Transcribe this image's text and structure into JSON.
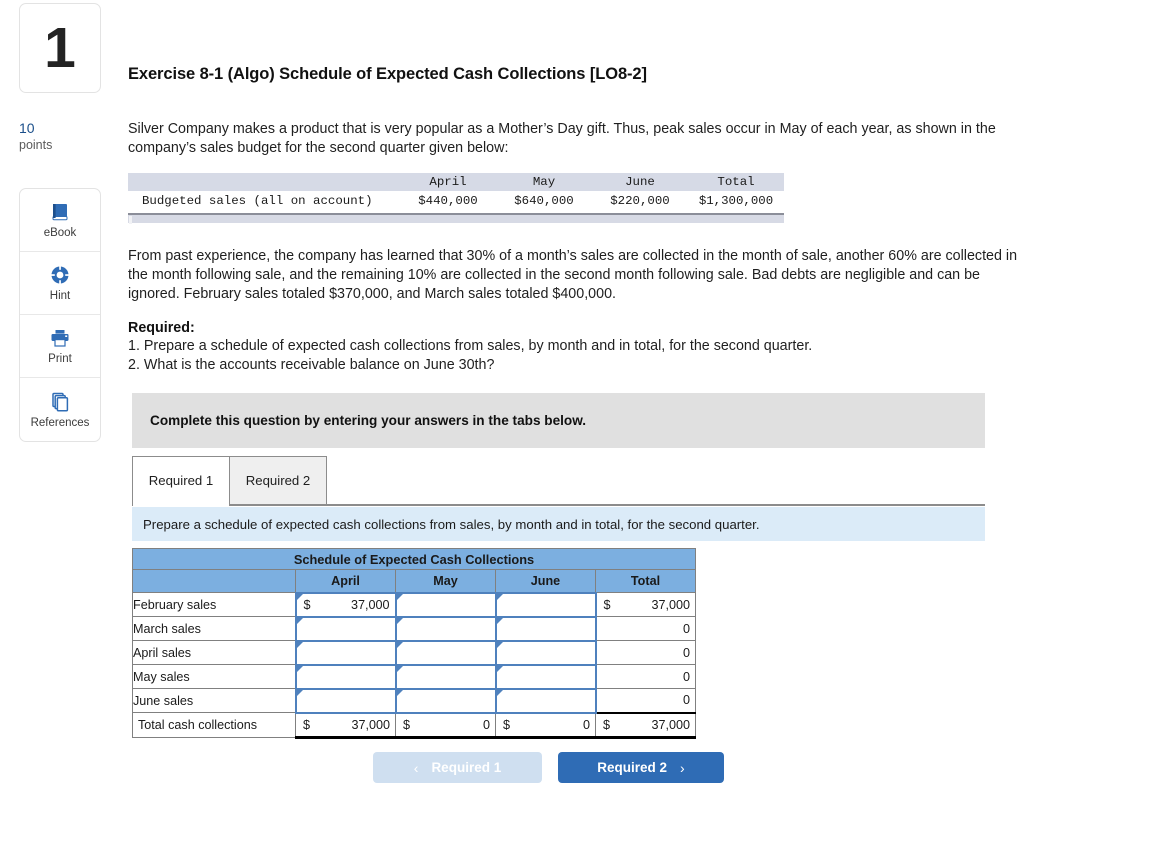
{
  "question": {
    "number": "1",
    "points_value": "10",
    "points_label": "points"
  },
  "tools": [
    {
      "label": "eBook",
      "icon": "book-icon"
    },
    {
      "label": "Hint",
      "icon": "life-ring-icon"
    },
    {
      "label": "Print",
      "icon": "printer-icon"
    },
    {
      "label": "References",
      "icon": "copy-documents-icon"
    }
  ],
  "exercise": {
    "title": "Exercise 8-1 (Algo) Schedule of Expected Cash Collections [LO8-2]",
    "intro": "Silver Company makes a product that is very popular as a Mother’s Day gift. Thus, peak sales occur in May of each year, as shown in the company’s sales budget for the second quarter given below:",
    "policy": "From past experience, the company has learned that 30% of a month’s sales are collected in the month of sale, another 60% are collected in the month following sale, and the remaining 10% are collected in the second month following sale. Bad debts are negligible and can be ignored. February sales totaled $370,000, and March sales totaled $400,000.",
    "required_heading": "Required:",
    "required_1": "1. Prepare a schedule of expected cash collections from sales, by month and in total, for the second quarter.",
    "required_2": "2. What is the accounts receivable balance on June 30th?"
  },
  "budget_table": {
    "columns": [
      "",
      "April",
      "May",
      "June",
      "Total"
    ],
    "row_label": "Budgeted sales (all on account)",
    "values": [
      "$440,000",
      "$640,000",
      "$220,000",
      "$1,300,000"
    ]
  },
  "complete_notice": "Complete this question by entering your answers in the tabs below.",
  "tabs": [
    {
      "label": "Required 1",
      "active": true
    },
    {
      "label": "Required 2",
      "active": false
    }
  ],
  "instruction": "Prepare a schedule of expected cash collections from sales, by month and in total, for the second quarter.",
  "schedule": {
    "title": "Schedule of Expected Cash Collections",
    "headers": [
      "",
      "April",
      "May",
      "June",
      "Total"
    ],
    "rows": [
      {
        "label": "February sales",
        "april_currency": "$",
        "april_value": "37,000",
        "may_currency": "",
        "may_value": "",
        "june_currency": "",
        "june_value": "",
        "total_currency": "$",
        "total_value": "37,000"
      },
      {
        "label": "March sales",
        "april_currency": "",
        "april_value": "",
        "may_currency": "",
        "may_value": "",
        "june_currency": "",
        "june_value": "",
        "total_currency": "",
        "total_value": "0"
      },
      {
        "label": "April sales",
        "april_currency": "",
        "april_value": "",
        "may_currency": "",
        "may_value": "",
        "june_currency": "",
        "june_value": "",
        "total_currency": "",
        "total_value": "0"
      },
      {
        "label": "May sales",
        "april_currency": "",
        "april_value": "",
        "may_currency": "",
        "may_value": "",
        "june_currency": "",
        "june_value": "",
        "total_currency": "",
        "total_value": "0"
      },
      {
        "label": "June sales",
        "april_currency": "",
        "april_value": "",
        "may_currency": "",
        "may_value": "",
        "june_currency": "",
        "june_value": "",
        "total_currency": "",
        "total_value": "0"
      }
    ],
    "total_row": {
      "label": "Total cash collections",
      "april_currency": "$",
      "april_value": "37,000",
      "may_currency": "$",
      "may_value": "0",
      "june_currency": "$",
      "june_value": "0",
      "total_currency": "$",
      "total_value": "37,000"
    }
  },
  "nav": {
    "prev_label": "Required 1",
    "prev_chevron": "‹",
    "next_label": "Required 2",
    "next_chevron": "›"
  },
  "colors": {
    "header_blue": "#7cafe0",
    "input_border_blue": "#4f81bd",
    "instruction_blue": "#dbebf8",
    "notice_gray": "#e0e0e0",
    "primary_button": "#2f6cb5",
    "disabled_button": "#cfdff0",
    "points_blue": "#1b4f8a"
  }
}
